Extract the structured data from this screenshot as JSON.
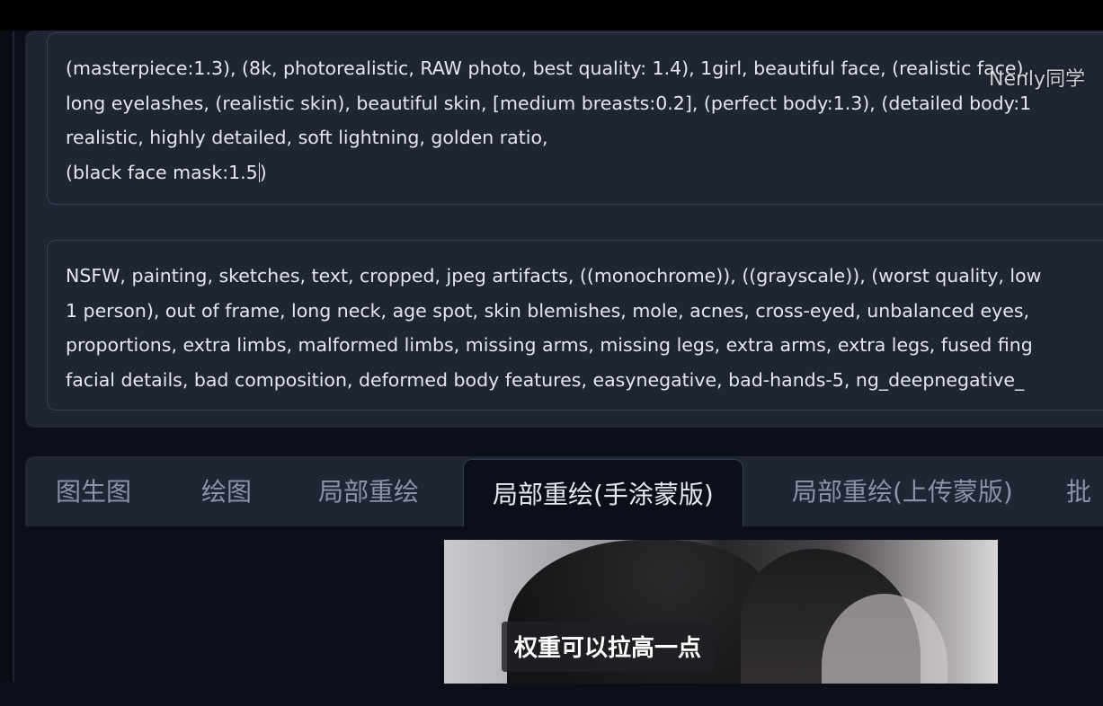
{
  "watermark": "Nenly同学",
  "positive_prompt": {
    "lines": [
      "(masterpiece:1.3), (8k, photorealistic, RAW photo, best quality: 1.4), 1girl, beautiful face, (realistic face),",
      "long eyelashes, (realistic skin), beautiful skin, [medium breasts:0.2], (perfect body:1.3), (detailed body:1",
      "realistic, highly detailed, soft lightning, golden ratio,",
      "(black face mask:1.5",
      ")"
    ]
  },
  "negative_prompt": {
    "lines": [
      "NSFW, painting, sketches, text, cropped, jpeg artifacts, ((monochrome)), ((grayscale)), (worst quality, low",
      "1 person), out of frame, long neck, age spot, skin blemishes, mole, acnes, cross-eyed, unbalanced eyes,",
      "proportions, extra limbs, malformed limbs, missing arms, missing legs, extra arms, extra legs, fused fing",
      "facial details, bad composition, deformed body features, easynegative, bad-hands-5, ng_deepnegative_"
    ]
  },
  "tabs": [
    {
      "label": "图生图"
    },
    {
      "label": "绘图"
    },
    {
      "label": "局部重绘"
    },
    {
      "label": "局部重绘(手涂蒙版)"
    },
    {
      "label": "局部重绘(上传蒙版)"
    },
    {
      "label": "批"
    }
  ],
  "active_tab": "局部重绘(手涂蒙版)",
  "subtitle": "权重可以拉高一点"
}
